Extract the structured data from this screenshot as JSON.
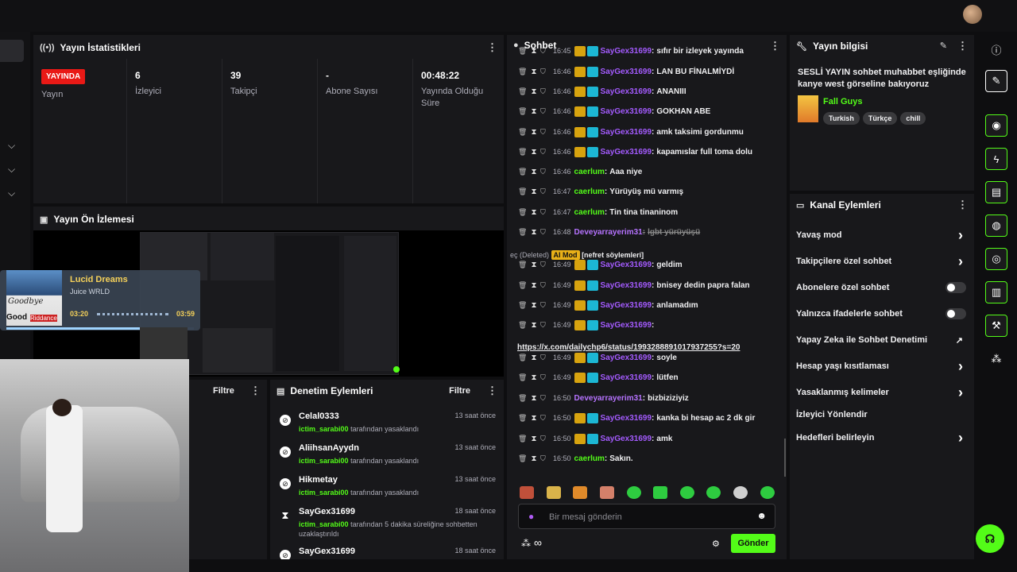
{
  "colors": {
    "accent": "#53fc18",
    "live": "#e91916",
    "bg": "#0e0e10",
    "panel": "#18181b"
  },
  "stats": {
    "title": "Yayın İstatistikleri",
    "live_badge": "YAYINDA",
    "live_label": "Yayın",
    "viewers": {
      "value": "6",
      "label": "İzleyici"
    },
    "followers": {
      "value": "39",
      "label": "Takipçi"
    },
    "subs": {
      "value": "-",
      "label": "Abone Sayısı"
    },
    "uptime": {
      "value": "00:48:22",
      "label": "Yayında Olduğu Süre"
    }
  },
  "preview": {
    "title": "Yayın Ön İzlemesi"
  },
  "music": {
    "title": "Lucid Dreams",
    "artist": "Juice WRLD",
    "elapsed": "03:20",
    "total": "03:59",
    "progress": 0.84,
    "art_text1": "Goodbye",
    "art_text2": "Good",
    "art_text3": "Riddance"
  },
  "left_filter": "Filtre",
  "modlog": {
    "title": "Denetim Eylemleri",
    "filter": "Filtre",
    "items": [
      {
        "user": "Celal0333",
        "by": "ictim_sarabi00",
        "action": "tarafından yasaklandı",
        "time": "13 saat önce"
      },
      {
        "user": "AliihsanAyydn",
        "by": "ictim_sarabi00",
        "action": "tarafından yasaklandı",
        "time": "13 saat önce"
      },
      {
        "user": "Hikmetay",
        "by": "ictim_sarabi00",
        "action": "tarafından yasaklandı",
        "time": "13 saat önce"
      },
      {
        "user": "SayGex31699",
        "by": "ictim_sarabi00",
        "action": "tarafından 5 dakika süreliğine sohbetten uzaklaştırıldı",
        "time": "18 saat önce"
      },
      {
        "user": "SayGex31699",
        "by": "",
        "action": "",
        "time": "18 saat önce"
      }
    ]
  },
  "chat": {
    "title": "Sohbet",
    "messages": [
      {
        "time": "16:45",
        "user": "SayGex31699",
        "text": "sıfır bir izleyek yayında"
      },
      {
        "time": "16:46",
        "user": "SayGex31699",
        "text": "LAN BU FİNALMİYDİ"
      },
      {
        "time": "16:46",
        "user": "SayGex31699",
        "text": "ANANIII"
      },
      {
        "time": "16:46",
        "user": "SayGex31699",
        "text": "GOKHAN ABE"
      },
      {
        "time": "16:46",
        "user": "SayGex31699",
        "text": "amk taksimi gordunmu"
      },
      {
        "time": "16:46",
        "user": "SayGex31699",
        "text": "kapamıslar full toma dolu"
      },
      {
        "time": "16:46",
        "user": "caerlum",
        "text": "Aaa niye"
      },
      {
        "time": "16:47",
        "user": "caerlum",
        "text": "Yürüyüş mü varmış"
      },
      {
        "time": "16:47",
        "user": "caerlum",
        "text": "Tin tina tinaninom"
      },
      {
        "time": "16:48",
        "user": "Deveyarrayerim31",
        "text": "lgbt yürüyüşü"
      },
      {
        "time": "16:49",
        "user": "SayGex31699",
        "text": "geldim"
      },
      {
        "time": "16:49",
        "user": "SayGex31699",
        "text": "bnisey dedin papra falan"
      },
      {
        "time": "16:49",
        "user": "SayGex31699",
        "text": "anlamadım"
      },
      {
        "time": "16:49",
        "user": "SayGex31699",
        "text": ""
      },
      {
        "time": "16:49",
        "user": "SayGex31699",
        "text": "soyle"
      },
      {
        "time": "16:49",
        "user": "SayGex31699",
        "text": "lütfen"
      },
      {
        "time": "16:50",
        "user": "Deveyarrayerim31",
        "text": "bizbiziziyiz"
      },
      {
        "time": "16:50",
        "user": "SayGex31699",
        "text": "kanka bi hesap ac 2 dk gir"
      },
      {
        "time": "16:50",
        "user": "SayGex31699",
        "text": "amk"
      },
      {
        "time": "16:50",
        "user": "caerlum",
        "text": "Sakın."
      }
    ],
    "deleted_note": {
      "prefix": "eç (Deleted)",
      "tag": "AI Mod",
      "reason": "[nefret söylemleri]"
    },
    "link": "https://x.com/dailychp6/status/1993288891017937255?s=20",
    "input_placeholder": "Bir mesaj gönderin",
    "send_label": "Gönder",
    "infinity": "∞"
  },
  "info": {
    "title": "Yayın bilgisi",
    "stream_title": "SESLİ YAYIN sohbet muhabbet eşliğinde kanye west görseline bakıyoruz",
    "category": "Fall Guys",
    "tags": [
      "Turkish",
      "Türkçe",
      "chill"
    ]
  },
  "actions": {
    "title": "Kanal Eylemleri",
    "items": [
      {
        "label": "Yavaş mod",
        "kind": "arrow"
      },
      {
        "label": "Takipçilere özel sohbet",
        "kind": "arrow"
      },
      {
        "label": "Abonelere özel sohbet",
        "kind": "toggle"
      },
      {
        "label": "Yalnızca ifadelerle sohbet",
        "kind": "toggle"
      },
      {
        "label": "Yapay Zeka ile Sohbet Denetimi",
        "kind": "external"
      },
      {
        "label": "Hesap yaşı kısıtlaması",
        "kind": "arrow"
      },
      {
        "label": "Yasaklanmış kelimeler",
        "kind": "arrow"
      },
      {
        "label": "İzleyici Yönlendir",
        "kind": "none"
      },
      {
        "label": "Hedefleri belirleyin",
        "kind": "arrow"
      }
    ]
  }
}
